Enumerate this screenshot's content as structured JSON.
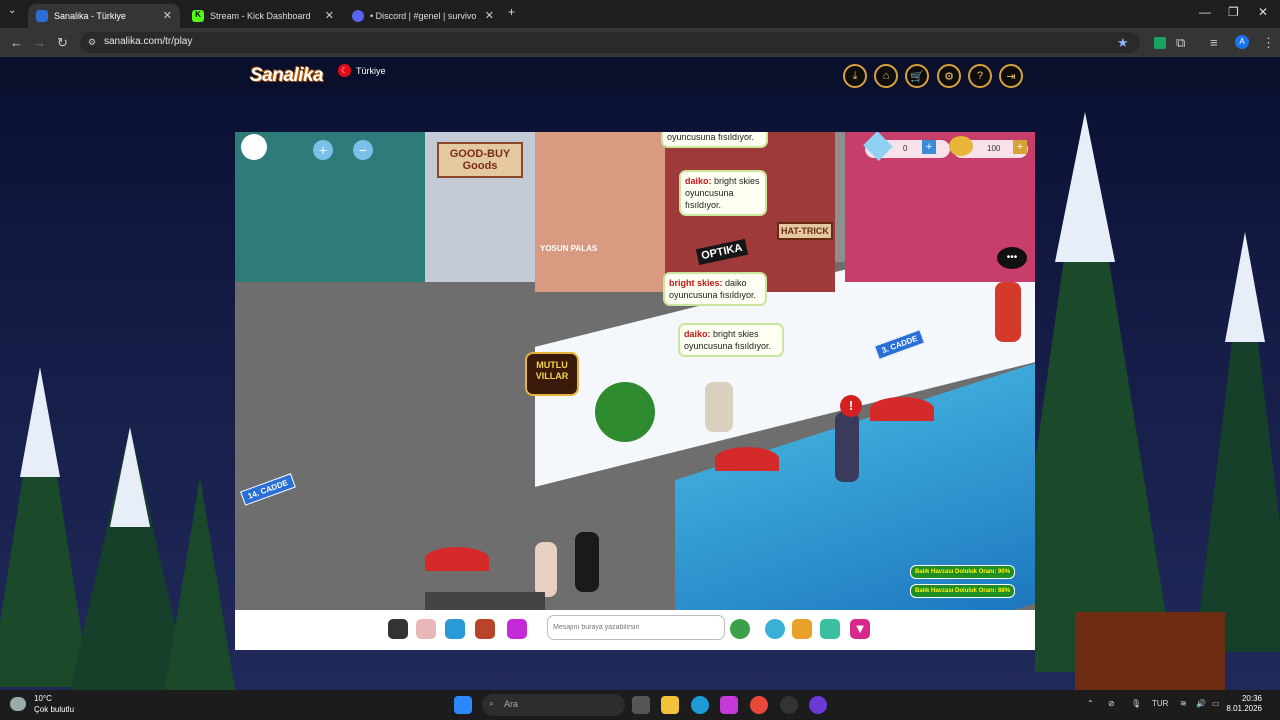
{
  "browser": {
    "tabs": [
      {
        "title": "Sanalika - Türkiye",
        "active": true,
        "color": "#2a6fd6"
      },
      {
        "title": "Stream - Kick Dashboard",
        "active": false,
        "color": "#53fc18"
      },
      {
        "title": "• Discord | #genel | survivo",
        "active": false,
        "color": "#5865f2"
      }
    ],
    "new_tab": "+",
    "url": "sanalika.com/tr/play",
    "window_controls": [
      "—",
      "❐",
      "✕"
    ]
  },
  "site": {
    "logo": "Sanalika",
    "language": "Türkiye",
    "header_buttons": [
      "download-icon",
      "home-icon",
      "cart-icon",
      "gear-icon",
      "help-icon",
      "logout-icon"
    ]
  },
  "game": {
    "resources": {
      "diamonds": "0",
      "coins": "100"
    },
    "chat_bubbles": [
      {
        "speaker": "",
        "text": "oyuncusuna fısıldıyor."
      },
      {
        "speaker": "daiko:",
        "text": "bright skies oyuncusuna fısıldıyor."
      },
      {
        "speaker": "bright skies:",
        "text": "daiko oyuncusuna fısıldıyor."
      },
      {
        "speaker": "daiko:",
        "text": "bright skies oyuncusuna fısıldıyor."
      }
    ],
    "signs": {
      "store": "GOOD-BUY Goods",
      "optika": "OPTIKA",
      "hattrick": "HAT-TRICK",
      "mutlu": "MUTLU VILLAR",
      "street3": "3. CADDE",
      "street14": "14. CADDE",
      "yosun": "YOSUN PALAS"
    },
    "pool_badges": [
      "Balık Havzası Doluluk Oranı: 90%",
      "Balık Havzası Doluluk Oranı: 88%"
    ]
  },
  "chat": {
    "placeholder": "Mesajını buraya yazabilirsin"
  },
  "taskbar": {
    "weather_temp": "10°C",
    "weather_desc": "Çok bulutlu",
    "search": "Ara",
    "lang": "TUR",
    "time": "20:36",
    "date": "8.01.2026"
  }
}
